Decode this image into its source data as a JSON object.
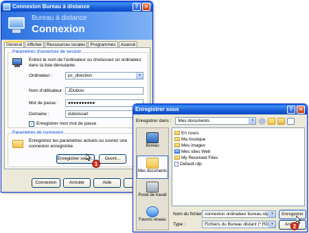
{
  "remote_window": {
    "title": "Connexion Bureau à distance",
    "banner_sub": "Bureau à distance",
    "banner_main": "Connexion",
    "tabs": [
      "Général",
      "Afficher",
      "Ressources locales",
      "Programmes",
      "Avancé"
    ],
    "session_group": {
      "legend": "Paramètres d'ouverture de session",
      "instructions": "Entrez le nom de l'ordinateur ou choisissez un ordinateur dans la liste déroulante.",
      "computer_label": "Ordinateur :",
      "computer_value": "pc_direction",
      "user_label": "Nom d'utilisateur :",
      "user_value": "JDubois",
      "password_label": "Mot de passe :",
      "password_value": "●●●●●●●●●●",
      "domain_label": "Domaine :",
      "domain_value": "duboissarl",
      "save_password_label": "Enregistrer mon mot de passe"
    },
    "connection_group": {
      "legend": "Paramètres de connexion",
      "text": "Enregistrez les paramètres actuels ou ouvrez une connexion enregistrée.",
      "save_as_button": "Enregistrer sous...",
      "open_button": "Ouvrir..."
    },
    "footer_buttons": [
      "Connexion",
      "Annuler",
      "Aide",
      "Op"
    ]
  },
  "save_dialog": {
    "title": "Enregistrer sous",
    "save_in_label": "Enregistrer dans :",
    "save_in_value": "Mes documents",
    "places": [
      "Bureau",
      "Mes documents",
      "Poste de travail",
      "Favoris réseau"
    ],
    "files": [
      "En cours",
      "Ma musique",
      "Mes images",
      "Mes sites Web",
      "My Received Files",
      "Default.rdp"
    ],
    "filename_label": "Nom du fichier :",
    "filename_value": "connexion ordinateur bureau.rdp",
    "type_label": "Type :",
    "type_value": "Fichiers du Bureau distant (*.RDP)",
    "save_button": "Enregistrer",
    "cancel_button": "Annuler"
  },
  "callouts": [
    "1",
    "2"
  ],
  "colors": {
    "titlebar": "#0a5bdb",
    "callout": "#d8321f",
    "group_legend": "#0046d5"
  }
}
